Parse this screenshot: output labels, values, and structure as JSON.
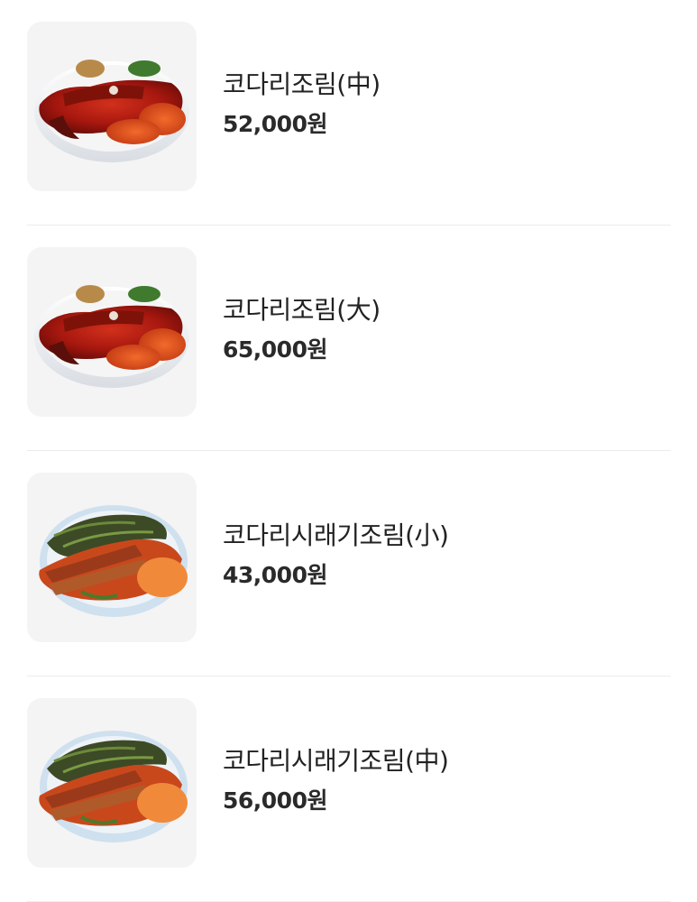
{
  "menu": {
    "items": [
      {
        "name": "코다리조림(中)",
        "price": "52,000원",
        "photo": "braised-pollack-dish-photo"
      },
      {
        "name": "코다리조림(大)",
        "price": "65,000원",
        "photo": "braised-pollack-dish-photo"
      },
      {
        "name": "코다리시래기조림(小)",
        "price": "43,000원",
        "photo": "braised-pollack-siraegi-dish-photo"
      },
      {
        "name": "코다리시래기조림(中)",
        "price": "56,000원",
        "photo": "braised-pollack-siraegi-dish-photo"
      }
    ]
  }
}
